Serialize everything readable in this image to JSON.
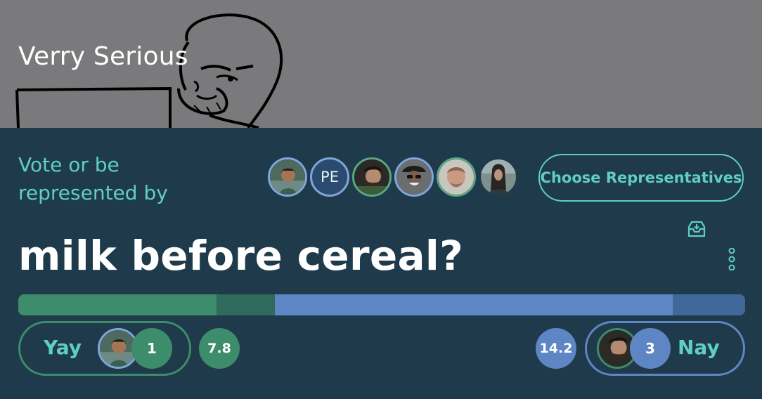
{
  "group": {
    "title": "Verry Serious"
  },
  "vote": {
    "prompt": "Vote or be represented by",
    "choose_label": "Choose Representatives",
    "question": "milk before cereal?"
  },
  "representatives": [
    {
      "type": "photo",
      "ring": "blue"
    },
    {
      "type": "initials",
      "initials": "PE",
      "ring": "blue"
    },
    {
      "type": "photo",
      "ring": "green"
    },
    {
      "type": "photo",
      "ring": "blue"
    },
    {
      "type": "photo",
      "ring": "green"
    },
    {
      "type": "photo",
      "ring": "none"
    }
  ],
  "tally": {
    "yay": {
      "label": "Yay",
      "count": "1",
      "score": "7.8"
    },
    "nay": {
      "label": "Nay",
      "count": "3",
      "score": "14.2"
    },
    "bar": {
      "yay_direct_fraction": 0.273,
      "yay_represented_fraction": 0.08,
      "nay_direct_fraction": 0.547,
      "nay_represented_fraction": 0.1
    }
  },
  "colors": {
    "accent": "#5fcfc0",
    "yay": "#3d8c6b",
    "yay_dark": "#2f6b5d",
    "nay": "#5f86c4",
    "nay_dark": "#41689a",
    "background": "#1f3b4b",
    "header_bg": "#7a7a7c"
  },
  "icons": {
    "inbox": "inbox-download-icon",
    "more": "more-vertical-icon"
  }
}
